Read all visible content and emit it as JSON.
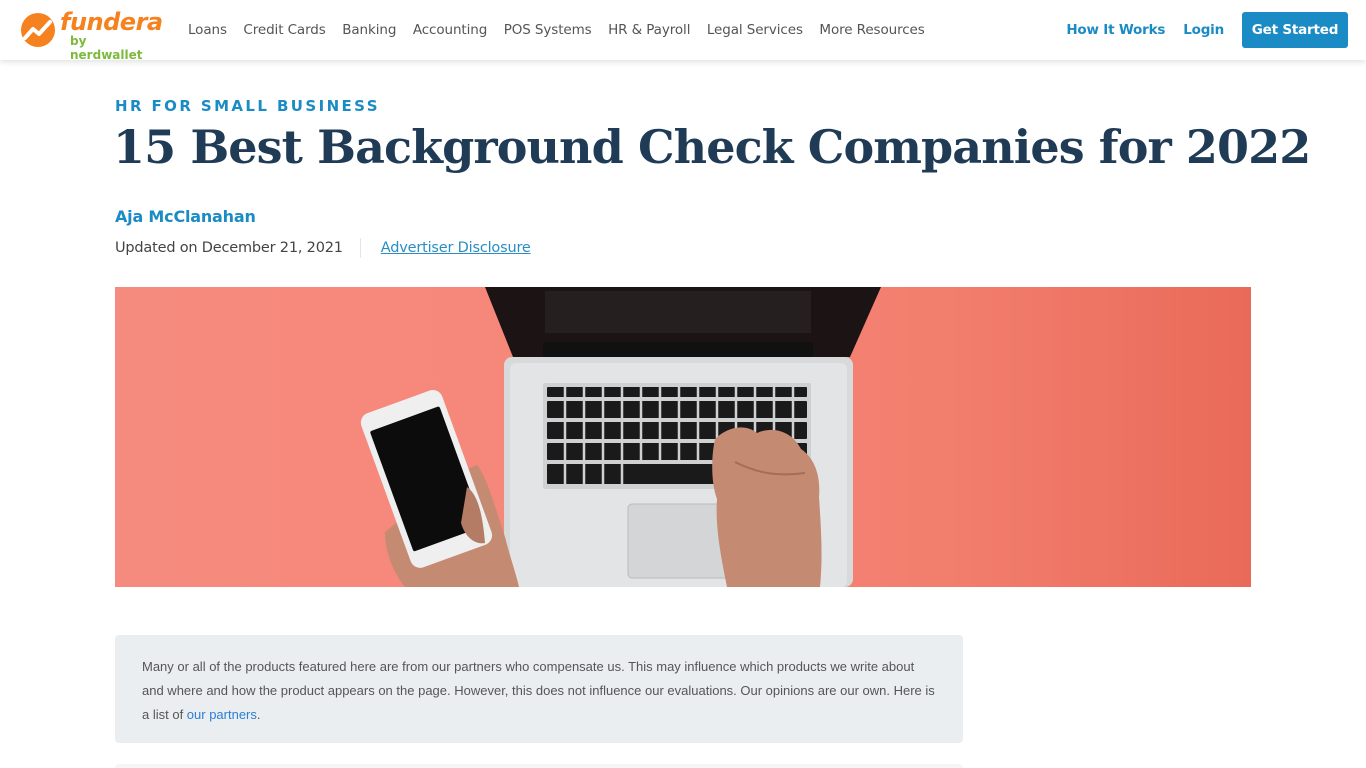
{
  "header": {
    "logo": {
      "name": "fundera",
      "sub": "by nerdwallet"
    },
    "nav": [
      {
        "label": "Loans"
      },
      {
        "label": "Credit Cards"
      },
      {
        "label": "Banking"
      },
      {
        "label": "Accounting"
      },
      {
        "label": "POS Systems"
      },
      {
        "label": "HR & Payroll"
      },
      {
        "label": "Legal Services"
      },
      {
        "label": "More Resources"
      }
    ],
    "how_it_works": "How It Works",
    "login": "Login",
    "get_started": "Get Started"
  },
  "article": {
    "category": "HR FOR SMALL BUSINESS",
    "title": "15 Best Background Check Companies for 2022",
    "author": "Aja McClanahan",
    "updated": "Updated on December 21, 2021",
    "disclosure_link": "Advertiser Disclosure",
    "hero_alt": "laptop-and-phone-on-coral-background"
  },
  "disclaimer": {
    "text": "Many or all of the products featured here are from our partners who compensate us. This may influence which products we write about and where and how the product appears on the page. However, this does not influence our evaluations. Our opinions are our own. Here is a list of ",
    "link": "our partners",
    "end": "."
  },
  "colors": {
    "brand_blue": "#1a8bc4",
    "brand_orange": "#f5821f",
    "brand_green": "#7dba3c",
    "title_navy": "#1f3b55",
    "hero_coral": "#f6887a"
  }
}
